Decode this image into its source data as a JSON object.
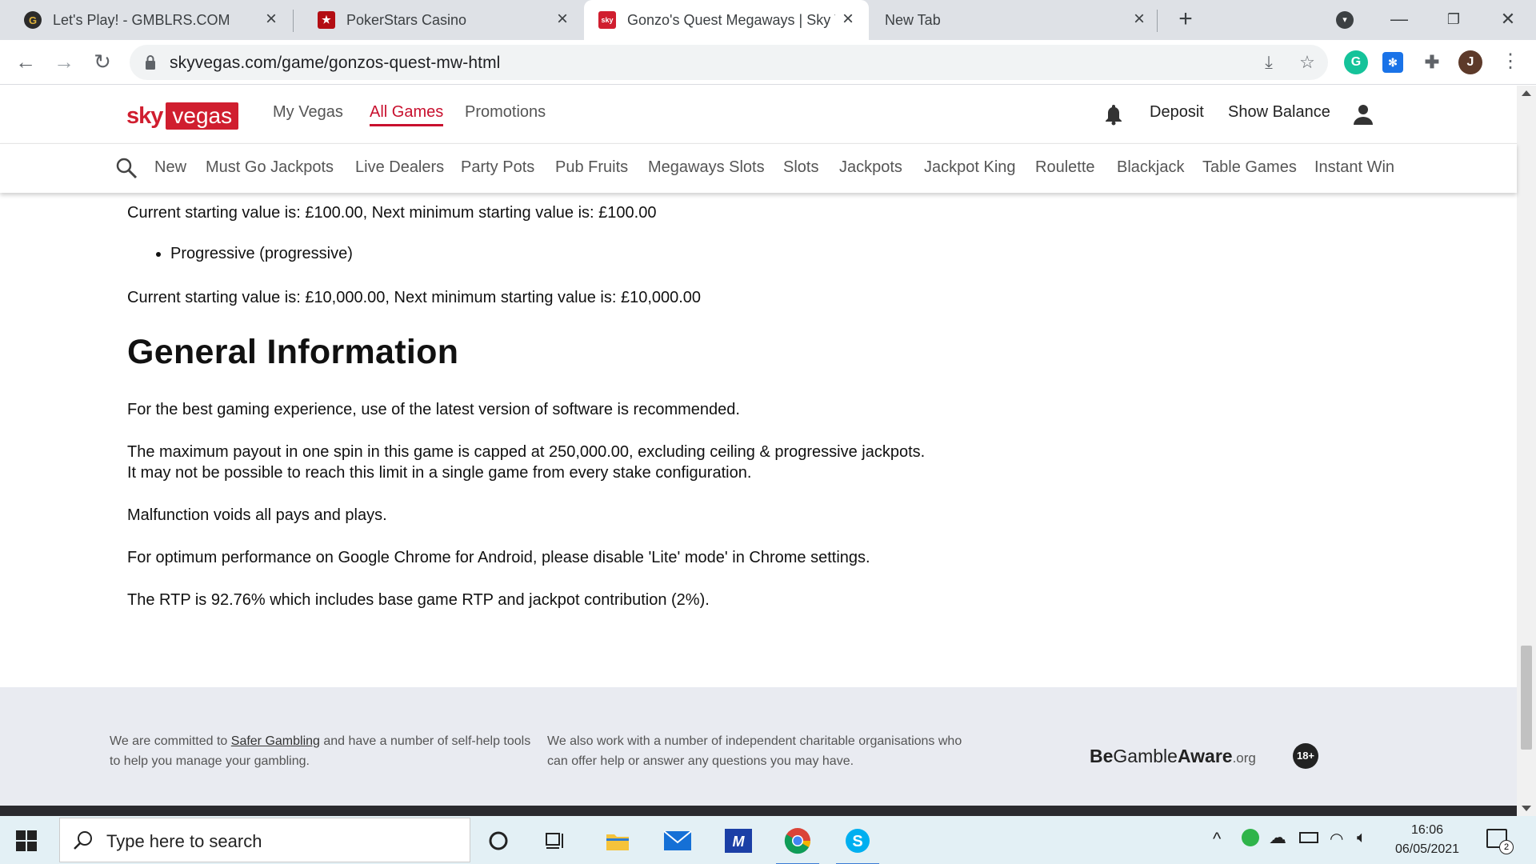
{
  "browser": {
    "tabs": [
      {
        "title": "Let's Play! - GMBLRS.COM",
        "favicon": "G"
      },
      {
        "title": "PokerStars Casino",
        "favicon": "★"
      },
      {
        "title": "Gonzo's Quest Megaways | Sky V",
        "favicon": "sky"
      },
      {
        "title": "New Tab",
        "favicon": ""
      }
    ],
    "url": "skyvegas.com/game/gonzos-quest-mw-html",
    "profile_initial": "J"
  },
  "site": {
    "logo_sky": "sky",
    "logo_vegas": "vegas",
    "main_nav": [
      "My Vegas",
      "All Games",
      "Promotions"
    ],
    "header_right": {
      "deposit": "Deposit",
      "show_balance": "Show Balance"
    },
    "categories": [
      "New",
      "Must Go Jackpots",
      "Live Dealers",
      "Party Pots",
      "Pub Fruits",
      "Megaways Slots",
      "Slots",
      "Jackpots",
      "Jackpot King",
      "Roulette",
      "Blackjack",
      "Table Games",
      "Instant Win"
    ]
  },
  "content": {
    "line1": "Current starting value is: £100.00, Next minimum starting value is: £100.00",
    "bullet": "Progressive (progressive)",
    "line2": "Current starting value is: £10,000.00, Next minimum starting value is: £10,000.00",
    "heading": "General Information",
    "p1": "For the best gaming experience, use of the latest version of software is recommended.",
    "p2": "The maximum payout in one spin in this game is capped at 250,000.00, excluding ceiling & progressive jackpots. It may not be possible to reach this limit in a single game from every stake configuration.",
    "p3": "Malfunction voids all pays and plays.",
    "p4": "For optimum performance on Google Chrome for Android, please disable 'Lite' mode' in Chrome settings.",
    "p5": "The RTP is 92.76% which includes base game RTP and jackpot contribution (2%)."
  },
  "footer": {
    "col1_pre": "We are committed to ",
    "col1_link": "Safer Gambling",
    "col1_post": " and have a number of self-help tools to help you manage your gambling.",
    "col2": "We also work with a number of independent charitable organisations who can offer help or answer any questions you may have.",
    "bga_be": "Be",
    "bga_gamble": "Gamble",
    "bga_aware": "Aware",
    "bga_org": ".org",
    "age": "18+"
  },
  "taskbar": {
    "search_placeholder": "Type here to search",
    "time": "16:06",
    "date": "06/05/2021",
    "notifications": "2"
  }
}
